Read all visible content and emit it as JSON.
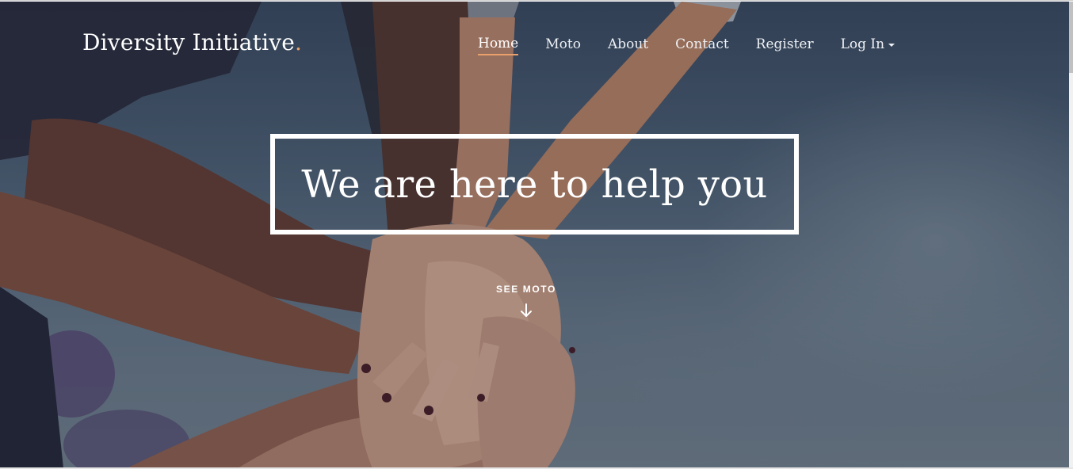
{
  "brand": {
    "name": "Diversity Initiative",
    "dot": "."
  },
  "nav": {
    "items": [
      {
        "label": "Home",
        "active": true
      },
      {
        "label": "Moto"
      },
      {
        "label": "About"
      },
      {
        "label": "Contact"
      },
      {
        "label": "Register"
      },
      {
        "label": "Log In",
        "has_dropdown": true
      }
    ]
  },
  "hero": {
    "headline": "We are here to help you",
    "cta_label": "SEE MOTO",
    "cta_icon": "arrow-down-icon"
  },
  "colors": {
    "accent": "#e9a06a",
    "text": "#ffffff"
  }
}
